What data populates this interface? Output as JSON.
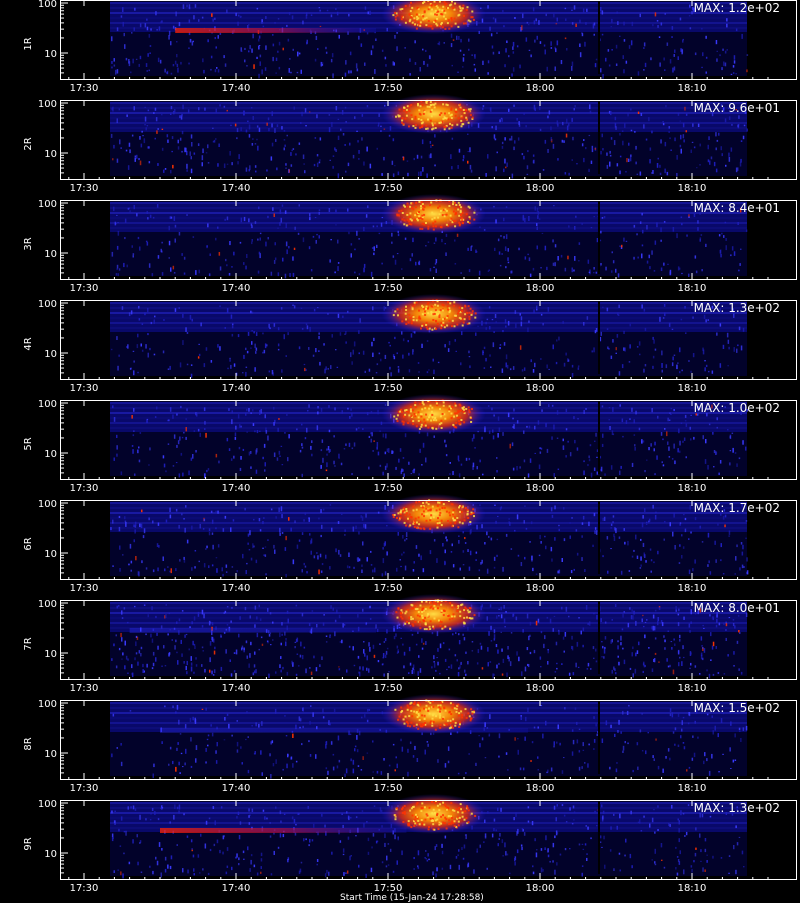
{
  "chart_data": [
    {
      "type": "heatmap",
      "panel_label": "1R",
      "max_label": "MAX: 1.2e+02",
      "x_ticks": [
        "17:30",
        "17:40",
        "17:50",
        "18:00",
        "18:10"
      ],
      "y_ticks": [
        "10",
        "100"
      ],
      "y_scale": "log",
      "features": {
        "peak_time": "17:53",
        "low_band_intensity": 0.75,
        "low_band_start": "17:36",
        "low_band_end": "17:40",
        "speckle": 0.3
      }
    },
    {
      "type": "heatmap",
      "panel_label": "2R",
      "max_label": "MAX: 9.6e+01",
      "x_ticks": [
        "17:30",
        "17:40",
        "17:50",
        "18:00",
        "18:10"
      ],
      "y_ticks": [
        "10",
        "100"
      ],
      "y_scale": "log",
      "features": {
        "peak_time": "17:53",
        "low_band_intensity": 0.0,
        "speckle": 0.35
      }
    },
    {
      "type": "heatmap",
      "panel_label": "3R",
      "max_label": "MAX: 8.4e+01",
      "x_ticks": [
        "17:30",
        "17:40",
        "17:50",
        "18:00",
        "18:10"
      ],
      "y_ticks": [
        "10",
        "100"
      ],
      "y_scale": "log",
      "features": {
        "peak_time": "17:53",
        "low_band_intensity": 0.0,
        "speckle": 0.2
      }
    },
    {
      "type": "heatmap",
      "panel_label": "4R",
      "max_label": "MAX: 1.3e+02",
      "x_ticks": [
        "17:30",
        "17:40",
        "17:50",
        "18:00",
        "18:10"
      ],
      "y_ticks": [
        "10",
        "100"
      ],
      "y_scale": "log",
      "features": {
        "peak_time": "17:53",
        "low_band_intensity": 0.0,
        "speckle": 0.2
      }
    },
    {
      "type": "heatmap",
      "panel_label": "5R",
      "max_label": "MAX: 1.0e+02",
      "x_ticks": [
        "17:30",
        "17:40",
        "17:50",
        "18:00",
        "18:10"
      ],
      "y_ticks": [
        "10",
        "100"
      ],
      "y_scale": "log",
      "features": {
        "peak_time": "17:53",
        "low_band_intensity": 0.0,
        "speckle": 0.3
      }
    },
    {
      "type": "heatmap",
      "panel_label": "6R",
      "max_label": "MAX: 1.7e+02",
      "x_ticks": [
        "17:30",
        "17:40",
        "17:50",
        "18:00",
        "18:10"
      ],
      "y_ticks": [
        "10",
        "100"
      ],
      "y_scale": "log",
      "features": {
        "peak_time": "17:53",
        "low_band_intensity": 0.0,
        "speckle": 0.3
      }
    },
    {
      "type": "heatmap",
      "panel_label": "7R",
      "max_label": "MAX: 8.0e+01",
      "x_ticks": [
        "17:30",
        "17:40",
        "17:50",
        "18:00",
        "18:10"
      ],
      "y_ticks": [
        "10",
        "100"
      ],
      "y_scale": "log",
      "features": {
        "peak_time": "17:53",
        "low_band_intensity": 0.35,
        "low_band_start": "17:33",
        "low_band_end": "17:40",
        "speckle": 0.6
      }
    },
    {
      "type": "heatmap",
      "panel_label": "8R",
      "max_label": "MAX: 1.5e+02",
      "x_ticks": [
        "17:30",
        "17:40",
        "17:50",
        "18:00",
        "18:10"
      ],
      "y_ticks": [
        "10",
        "100"
      ],
      "y_scale": "log",
      "features": {
        "peak_time": "17:53",
        "low_band_intensity": 0.3,
        "low_band_start": "17:35",
        "low_band_end": "17:50",
        "speckle": 0.15
      }
    },
    {
      "type": "heatmap",
      "panel_label": "9R",
      "max_label": "MAX: 1.3e+02",
      "x_ticks": [
        "17:30",
        "17:40",
        "17:50",
        "18:00",
        "18:10"
      ],
      "y_ticks": [
        "10",
        "100"
      ],
      "y_scale": "log",
      "features": {
        "peak_time": "17:53",
        "low_band_intensity": 0.75,
        "low_band_start": "17:35",
        "low_band_end": "17:42",
        "speckle": 0.3
      }
    }
  ],
  "colors": {
    "background": "#000000",
    "axis": "#ffffff",
    "cold": "#000033",
    "mid": "#1a1aff",
    "warm": "#ff3300",
    "hot": "#ffdd44"
  },
  "x_caption": "Start Time (15-Jan-24 17:28:58)"
}
